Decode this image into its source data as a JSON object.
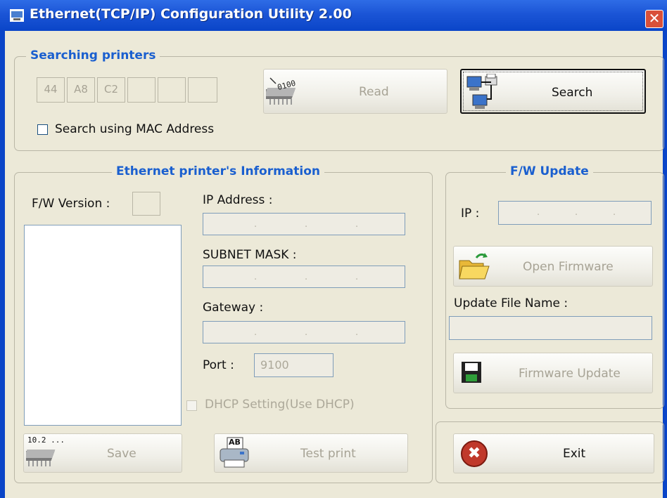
{
  "window": {
    "title": "Ethernet(TCP/IP) Configuration Utility 2.00",
    "close_glyph": "✕"
  },
  "search": {
    "legend": "Searching printers",
    "mac_octets": [
      "44",
      "A8",
      "C2",
      "",
      "",
      ""
    ],
    "read_label": "Read",
    "search_label": "Search",
    "mac_checkbox_label": "Search using MAC Address",
    "read_icon_text": "0100"
  },
  "info": {
    "legend": "Ethernet printer's Information",
    "fw_version_label": "F/W Version :",
    "fw_version_value": "",
    "ip_label": "IP Address :",
    "subnet_label": "SUBNET MASK :",
    "gateway_label": "Gateway :",
    "port_label": "Port :",
    "port_value": "9100",
    "dhcp_label": "DHCP Setting(Use DHCP)",
    "ip_dots": ".",
    "save_label": "Save",
    "save_icon_text": "10.2 ...",
    "test_print_label": "Test print",
    "test_print_icon_text": "AB"
  },
  "fw_update": {
    "legend": "F/W Update",
    "ip_label": "IP :",
    "open_firmware_label": "Open Firmware",
    "update_file_label": "Update File Name :",
    "update_file_value": "",
    "firmware_update_label": "Firmware Update"
  },
  "exit": {
    "label": "Exit",
    "icon_glyph": "✖"
  },
  "colors": {
    "titlebar": "#0A45C8",
    "legend": "#1A5FCF",
    "window_bg": "#ECE9D8",
    "exit_icon": "#C0392B"
  }
}
